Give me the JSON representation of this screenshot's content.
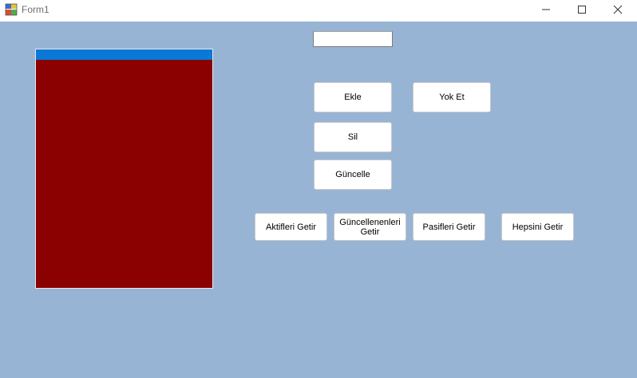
{
  "window": {
    "title": "Form1",
    "minimize_icon": "minimize-icon",
    "maximize_icon": "maximize-icon",
    "close_icon": "close-icon"
  },
  "colors": {
    "client_background": "#98b4d4",
    "listbox_background": "#8b0000",
    "selection": "#0a78d7"
  },
  "input": {
    "value": ""
  },
  "buttons": {
    "ekle": "Ekle",
    "yok_et": "Yok Et",
    "sil": "Sil",
    "guncelle": "Güncelle",
    "aktifleri_getir": "Aktifleri Getir",
    "guncellenenleri_getir": "Güncellenenleri Getir",
    "pasifleri_getir": "Pasifleri Getir",
    "hepsini_getir": "Hepsini Getir"
  }
}
